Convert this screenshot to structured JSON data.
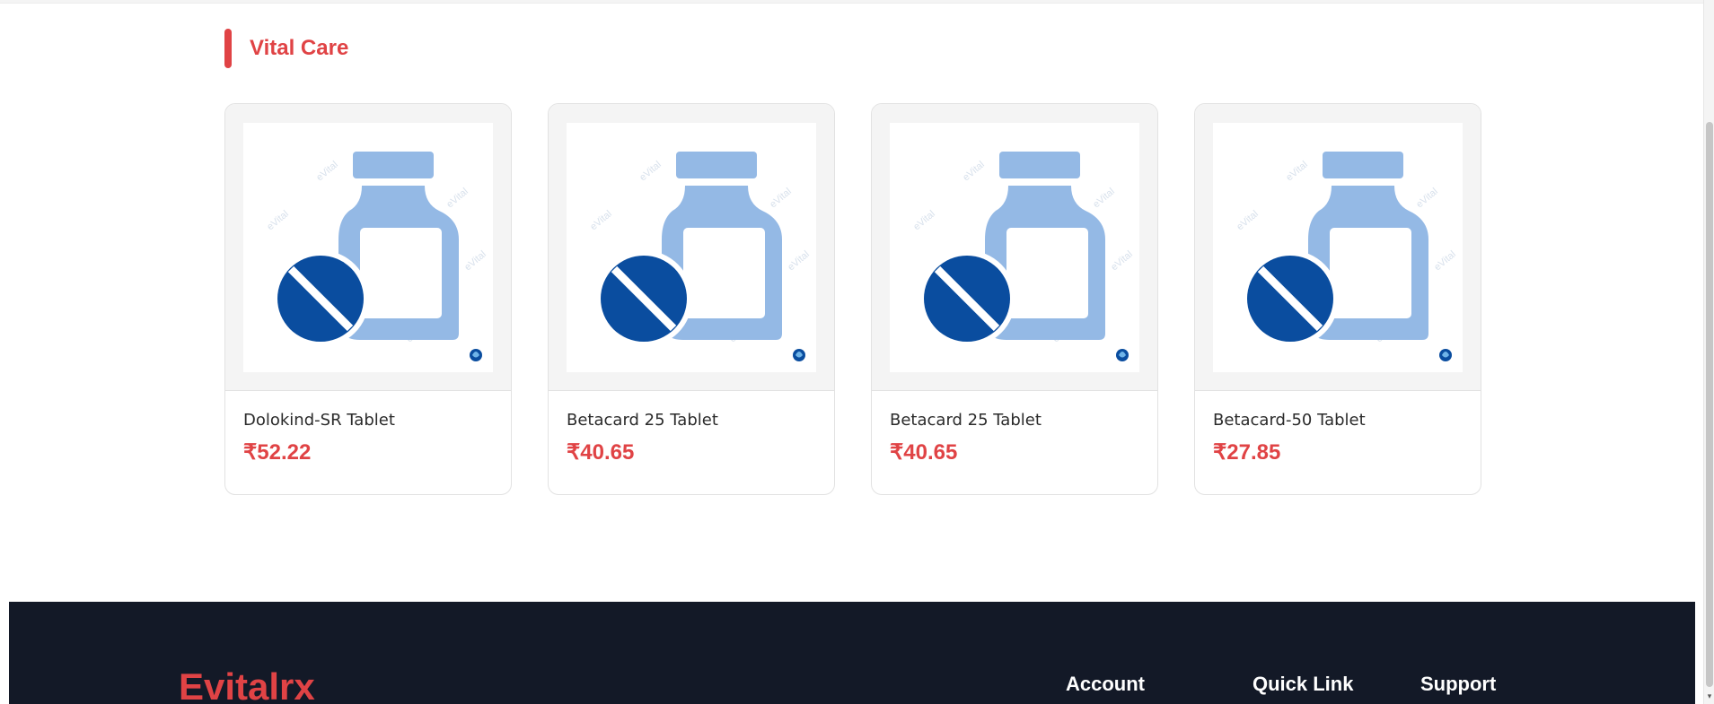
{
  "section": {
    "title": "Vital Care"
  },
  "products": [
    {
      "name": "Dolokind-SR Tablet",
      "price": "₹52.22",
      "image_icon": "medicine-bottle-pill-icon"
    },
    {
      "name": "Betacard 25 Tablet",
      "price": "₹40.65",
      "image_icon": "medicine-bottle-pill-icon"
    },
    {
      "name": "Betacard 25 Tablet",
      "price": "₹40.65",
      "image_icon": "medicine-bottle-pill-icon"
    },
    {
      "name": "Betacard-50 Tablet",
      "price": "₹27.85",
      "image_icon": "medicine-bottle-pill-icon"
    }
  ],
  "watermark": {
    "text": "eVital"
  },
  "footer": {
    "logo": "Evitalrx",
    "columns": [
      "Account",
      "Quick Link",
      "Support"
    ]
  },
  "colors": {
    "accent": "#e04345",
    "footer_bg": "#131927",
    "bottle": "#94b9e5",
    "pill": "#0a4d9f",
    "card_bg": "#f4f4f4"
  }
}
